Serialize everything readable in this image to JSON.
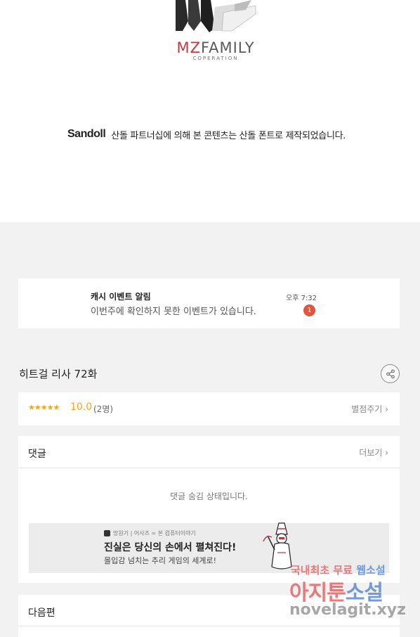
{
  "logo": {
    "name_accent": "MZ",
    "name_rest": "FAMILY",
    "sub": "COPERATION"
  },
  "credit": {
    "brand": "Sandoll",
    "text": "산돌 파트너십에 의해 본 콘텐츠는 산돌 폰트로 제작되었습니다."
  },
  "notification": {
    "title": "캐시 이벤트 알림",
    "body": "이번주에 확인하지 못한 이벤트가 있습니다.",
    "time": "오후 7:32",
    "badge": "1",
    "badge_color": "#e2553c"
  },
  "episode": {
    "title": "히트걸 리사 72화"
  },
  "rating": {
    "stars": "★★★★★",
    "score": "10.0",
    "count": "(2명)",
    "rate_label": "별점주기",
    "star_color": "#f2a71b"
  },
  "comments": {
    "title": "댓글",
    "more_label": "더보기",
    "hidden_message": "댓글 숨김 상태입니다."
  },
  "ad": {
    "source": "망원기 | 어사즈 = 본 컴퓨터이야기",
    "headline": "진실은 당신의 손에서 펼쳐진다!",
    "sub": "몰입감 넘치는 추리 게임의 세계로!"
  },
  "next": {
    "title": "다음편"
  },
  "watermark": {
    "line1_a": "국내최초 무료 ",
    "line1_b": "웹소설",
    "line2_a": "아지툰",
    "line2_b": "소설",
    "line3": "novelagit.xyz"
  },
  "icons": {
    "share": "share-icon",
    "chevron": "chevron-right-icon"
  }
}
